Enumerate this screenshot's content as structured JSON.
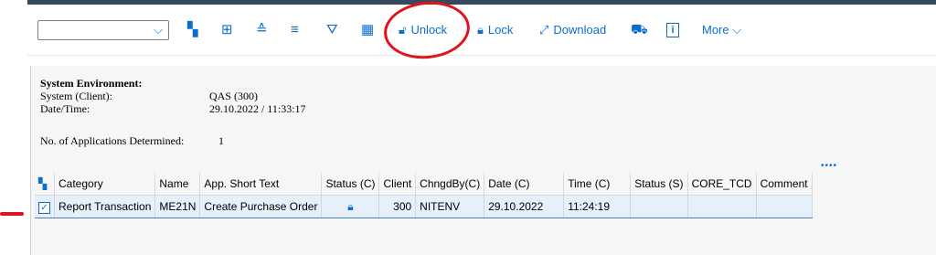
{
  "toolbar": {
    "dropdown_value": "",
    "unlock_label": "Unlock",
    "lock_label": "Lock",
    "download_label": "Download",
    "more_label": "More"
  },
  "info": {
    "heading": "System Environment:",
    "system_label": "System (Client):",
    "system_value": "QAS (300)",
    "datetime_label": "Date/Time:",
    "datetime_value": "29.10.2022 / 11:33:17",
    "apps_label": "No. of Applications Determined:",
    "apps_value": "1"
  },
  "table": {
    "columns": [
      "Category",
      "Name",
      "App. Short Text",
      "Status (C)",
      "Client",
      "ChngdBy(C)",
      "Date (C)",
      "Time (C)",
      "Status (S)",
      "CORE_TCD",
      "Comment"
    ],
    "rows": [
      {
        "checked": true,
        "category": "Report Transaction",
        "name": "ME21N",
        "short_text": "Create Purchase Order",
        "status_c": "lock-icon",
        "client": "300",
        "changed_by": "NITENV",
        "date": "29.10.2022",
        "time": "11:24:19",
        "status_s": "",
        "core_tcd": "",
        "comment": ""
      }
    ]
  },
  "colors": {
    "accent": "#0a6ed1",
    "annotation": "#e2141b",
    "selected_row": "#e6f0fb"
  }
}
